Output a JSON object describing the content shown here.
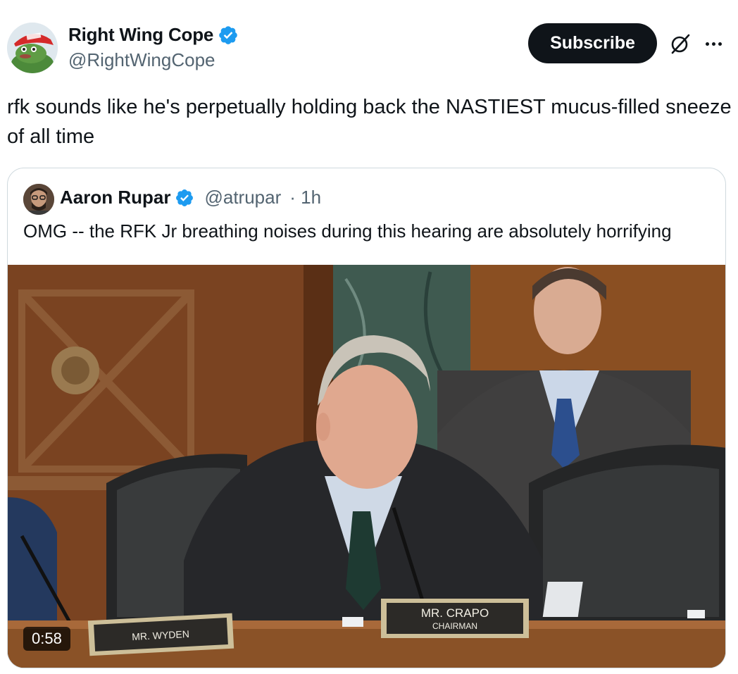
{
  "author": {
    "display_name": "Right Wing Cope",
    "handle": "@RightWingCope",
    "verified": true
  },
  "actions": {
    "subscribe_label": "Subscribe",
    "grok_icon": "grok-icon",
    "more_icon": "more-icon"
  },
  "tweet": {
    "text": "rfk sounds like he's perpetually holding back the NASTIEST mucus-filled sneeze of all time"
  },
  "quoted_tweet": {
    "display_name": "Aaron Rupar",
    "handle": "@atrupar",
    "time": "· 1h",
    "verified": true,
    "text": "OMG -- the RFK Jr breathing noises during this hearing are absolutely horrifying",
    "video": {
      "duration": "0:58",
      "placard_left": "MR. WYDEN",
      "placard_center_name": "MR. CRAPO",
      "placard_center_title": "CHAIRMAN"
    }
  },
  "colors": {
    "text_primary": "#0f1419",
    "text_secondary": "#536471",
    "verified_blue": "#1d9bf0",
    "border": "#cfd9de",
    "button_bg": "#0f1419"
  }
}
